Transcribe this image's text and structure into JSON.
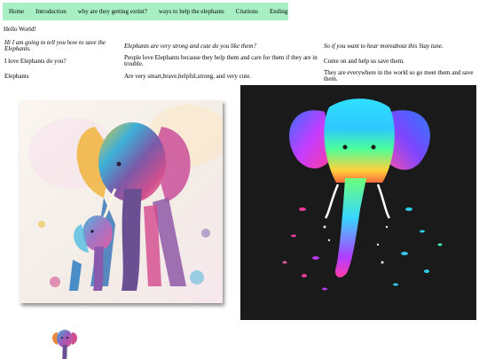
{
  "nav": {
    "items": [
      {
        "label": "Home"
      },
      {
        "label": "Introduction"
      },
      {
        "label": "why are they getting extint?"
      },
      {
        "label": "ways to help the elephants"
      },
      {
        "label": "Citations"
      },
      {
        "label": "Ending"
      }
    ]
  },
  "greeting": "Hello World!",
  "columns": [
    {
      "heading": "Hi I am going to tell you how to save the Elephants.",
      "line1": "I love Elephants do you?",
      "line2": "Elephants"
    },
    {
      "heading": "Elephants are very strong and cute do you like them?",
      "line1": "People love Elephants because they help them and care for them if they are in trouble.",
      "line2": "Are very smart,brave,helpful,strong, and very cute."
    },
    {
      "heading": "So if you want to hear moreabout this Stay tune.",
      "line1": "Come on and help us save them.",
      "line2": "They are everywhere in the world so go meet them and save them."
    }
  ],
  "images": {
    "painting": "watercolor-elephant-mother-and-calf",
    "neon": "neon-rainbow-elephant-head",
    "small": "colorful-elephant-thumbnail"
  }
}
